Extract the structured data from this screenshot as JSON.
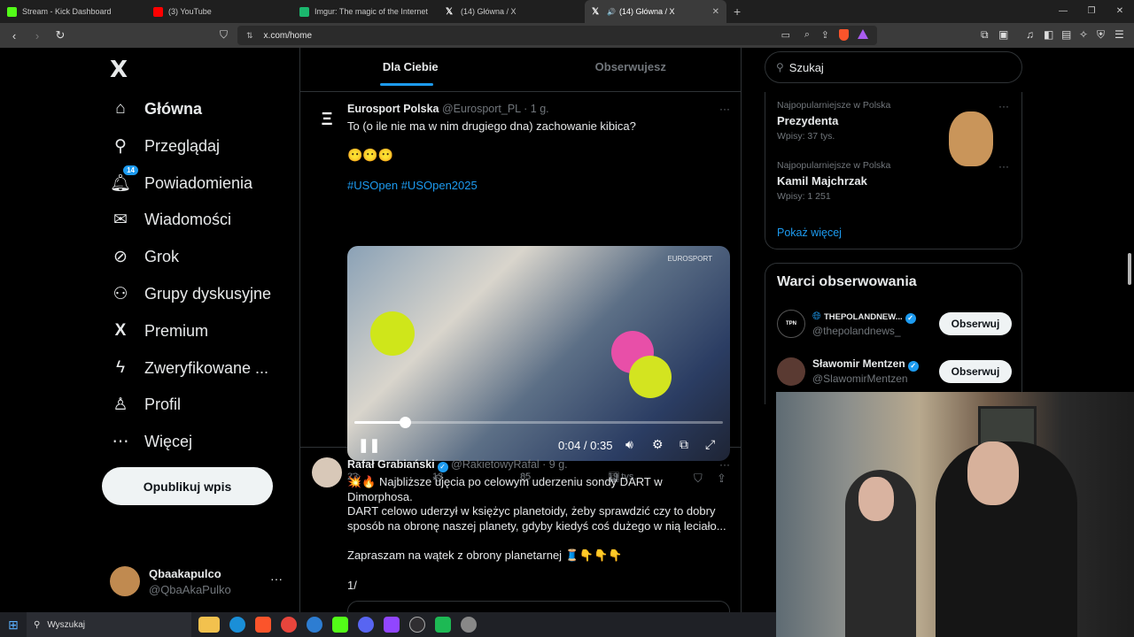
{
  "browser": {
    "tabs": [
      {
        "title": "Stream - Kick Dashboard",
        "color": "#53fc18"
      },
      {
        "title": "(3) YouTube",
        "color": "#ff0000"
      },
      {
        "title": "Imgur: The magic of the Internet",
        "color": "#1bb76e"
      },
      {
        "title": "(14) Główna / X",
        "color": "#ffffff"
      },
      {
        "title": "(14) Główna / X",
        "color": "#ffffff"
      }
    ],
    "url": "x.com/home"
  },
  "nav": {
    "logo": "X",
    "items": [
      {
        "label": "Główna",
        "icon": "home-icon"
      },
      {
        "label": "Przeglądaj",
        "icon": "search-icon"
      },
      {
        "label": "Powiadomienia",
        "icon": "bell-icon",
        "badge": "14"
      },
      {
        "label": "Wiadomości",
        "icon": "envelope-icon"
      },
      {
        "label": "Grok",
        "icon": "grok-icon"
      },
      {
        "label": "Grupy dyskusyjne",
        "icon": "people-icon"
      },
      {
        "label": "Premium",
        "icon": "x-premium-icon"
      },
      {
        "label": "Zweryfikowane ...",
        "icon": "lightning-icon"
      },
      {
        "label": "Profil",
        "icon": "person-icon"
      },
      {
        "label": "Więcej",
        "icon": "more-circle-icon"
      }
    ],
    "post_button": "Opublikuj wpis",
    "account": {
      "name": "Qbaakapulco",
      "handle": "@QbaAkaPulko"
    }
  },
  "feed": {
    "tabs": [
      "Dla Ciebie",
      "Obserwujesz"
    ],
    "tweets": [
      {
        "name": "Eurosport Polska",
        "handle": "@Eurosport_PL",
        "time": "· 1 g.",
        "text": "To (o ile nie ma w nim drugiego dna)  zachowanie kibica?",
        "emoji": "😶😶😶",
        "hashtags": "#USOpen #USOpen2025",
        "video": {
          "time": "0:04 / 0:35",
          "watermark": "EUROSPORT",
          "progress": 0.137
        },
        "stats": {
          "replies": "23",
          "reposts": "13",
          "likes": "85",
          "views": "19 tys."
        }
      },
      {
        "name": "Rafał Grabiański",
        "handle": "@RakietowyRafal",
        "time": "· 9 g.",
        "line1": "💥🔥 Najbliższe ujęcia po celowym uderzeniu sondy DART w Dimorphosa.",
        "line2": "DART celowo uderzył w księżyc planetoidy, żeby sprawdzić czy to dobry sposób na obronę naszej planety, gdyby kiedyś coś dużego w nią leciało...",
        "line3": "Zapraszam na wątek z obrony planetarnej 🧵👇👇👇",
        "line4": "1/"
      }
    ]
  },
  "sidebar": {
    "search_placeholder": "Szukaj",
    "trends": [
      {
        "category": "Najpopularniejsze w Polska",
        "name": "Prezydenta",
        "count": "Wpisy: 37 tys."
      },
      {
        "category": "Najpopularniejsze w Polska",
        "name": "Kamil Majchrzak",
        "count": "Wpisy: 1 251"
      }
    ],
    "show_more": "Pokaż więcej",
    "who_to_follow": {
      "title": "Warci obserwowania",
      "accounts": [
        {
          "name": "THEPOLANDNEW...",
          "handle": "@thepolandnews_",
          "button": "Obserwuj",
          "avatar_text": "TPN"
        },
        {
          "name": "Sławomir Mentzen",
          "handle": "@SlawomirMentzen",
          "button": "Obserwuj"
        }
      ]
    }
  },
  "taskbar": {
    "search": "Wyszukaj"
  }
}
